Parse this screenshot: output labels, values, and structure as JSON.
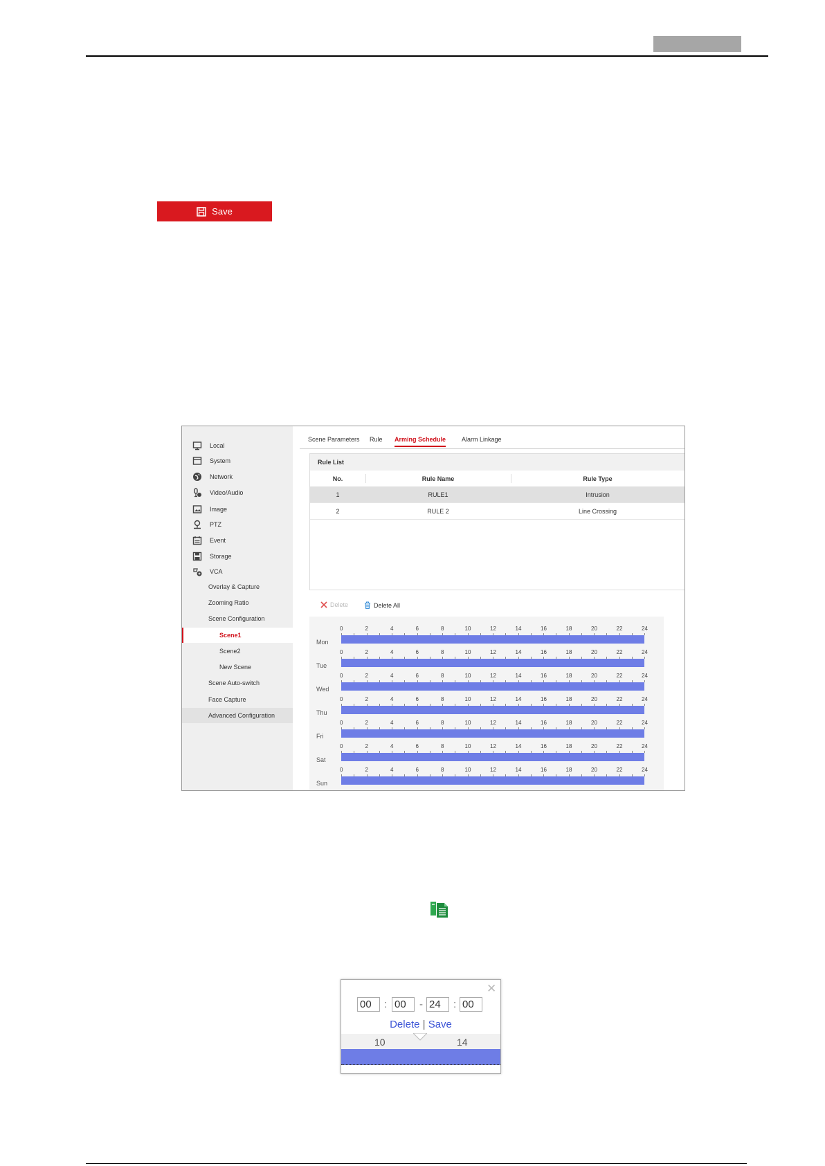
{
  "save_button": {
    "label": "Save"
  },
  "tabs": [
    {
      "label": "Scene Parameters"
    },
    {
      "label": "Rule"
    },
    {
      "label": "Arming Schedule"
    },
    {
      "label": "Alarm Linkage"
    }
  ],
  "sidebar": {
    "items": [
      {
        "label": "Local"
      },
      {
        "label": "System"
      },
      {
        "label": "Network"
      },
      {
        "label": "Video/Audio"
      },
      {
        "label": "Image"
      },
      {
        "label": "PTZ"
      },
      {
        "label": "Event"
      },
      {
        "label": "Storage"
      },
      {
        "label": "VCA"
      }
    ],
    "sub_items": [
      {
        "label": "Overlay & Capture"
      },
      {
        "label": "Zooming Ratio"
      },
      {
        "label": "Scene Configuration"
      }
    ],
    "scenes": [
      {
        "label": "Scene1"
      },
      {
        "label": "Scene2"
      },
      {
        "label": "New Scene"
      }
    ],
    "more_items": [
      {
        "label": "Scene Auto-switch"
      },
      {
        "label": "Face Capture"
      },
      {
        "label": "Advanced Configuration"
      }
    ]
  },
  "rule_list": {
    "title": "Rule List",
    "columns": [
      "No.",
      "Rule Name",
      "Rule Type"
    ],
    "rows": [
      {
        "no": "1",
        "name": "RULE1",
        "type": "Intrusion"
      },
      {
        "no": "2",
        "name": "RULE 2",
        "type": "Line Crossing"
      }
    ]
  },
  "schedule_actions": {
    "delete": "Delete",
    "delete_all": "Delete All"
  },
  "schedule": {
    "days": [
      "Mon",
      "Tue",
      "Wed",
      "Thu",
      "Fri",
      "Sat",
      "Sun"
    ],
    "hour_labels": [
      "0",
      "2",
      "4",
      "6",
      "8",
      "10",
      "12",
      "14",
      "16",
      "18",
      "20",
      "22",
      "24"
    ]
  },
  "time_popup": {
    "start_hour": "00",
    "start_minute": "00",
    "end_hour": "24",
    "end_minute": "00",
    "delete_label": "Delete",
    "separator": "|",
    "save_label": "Save",
    "ruler_left": "10",
    "ruler_right": "14"
  }
}
